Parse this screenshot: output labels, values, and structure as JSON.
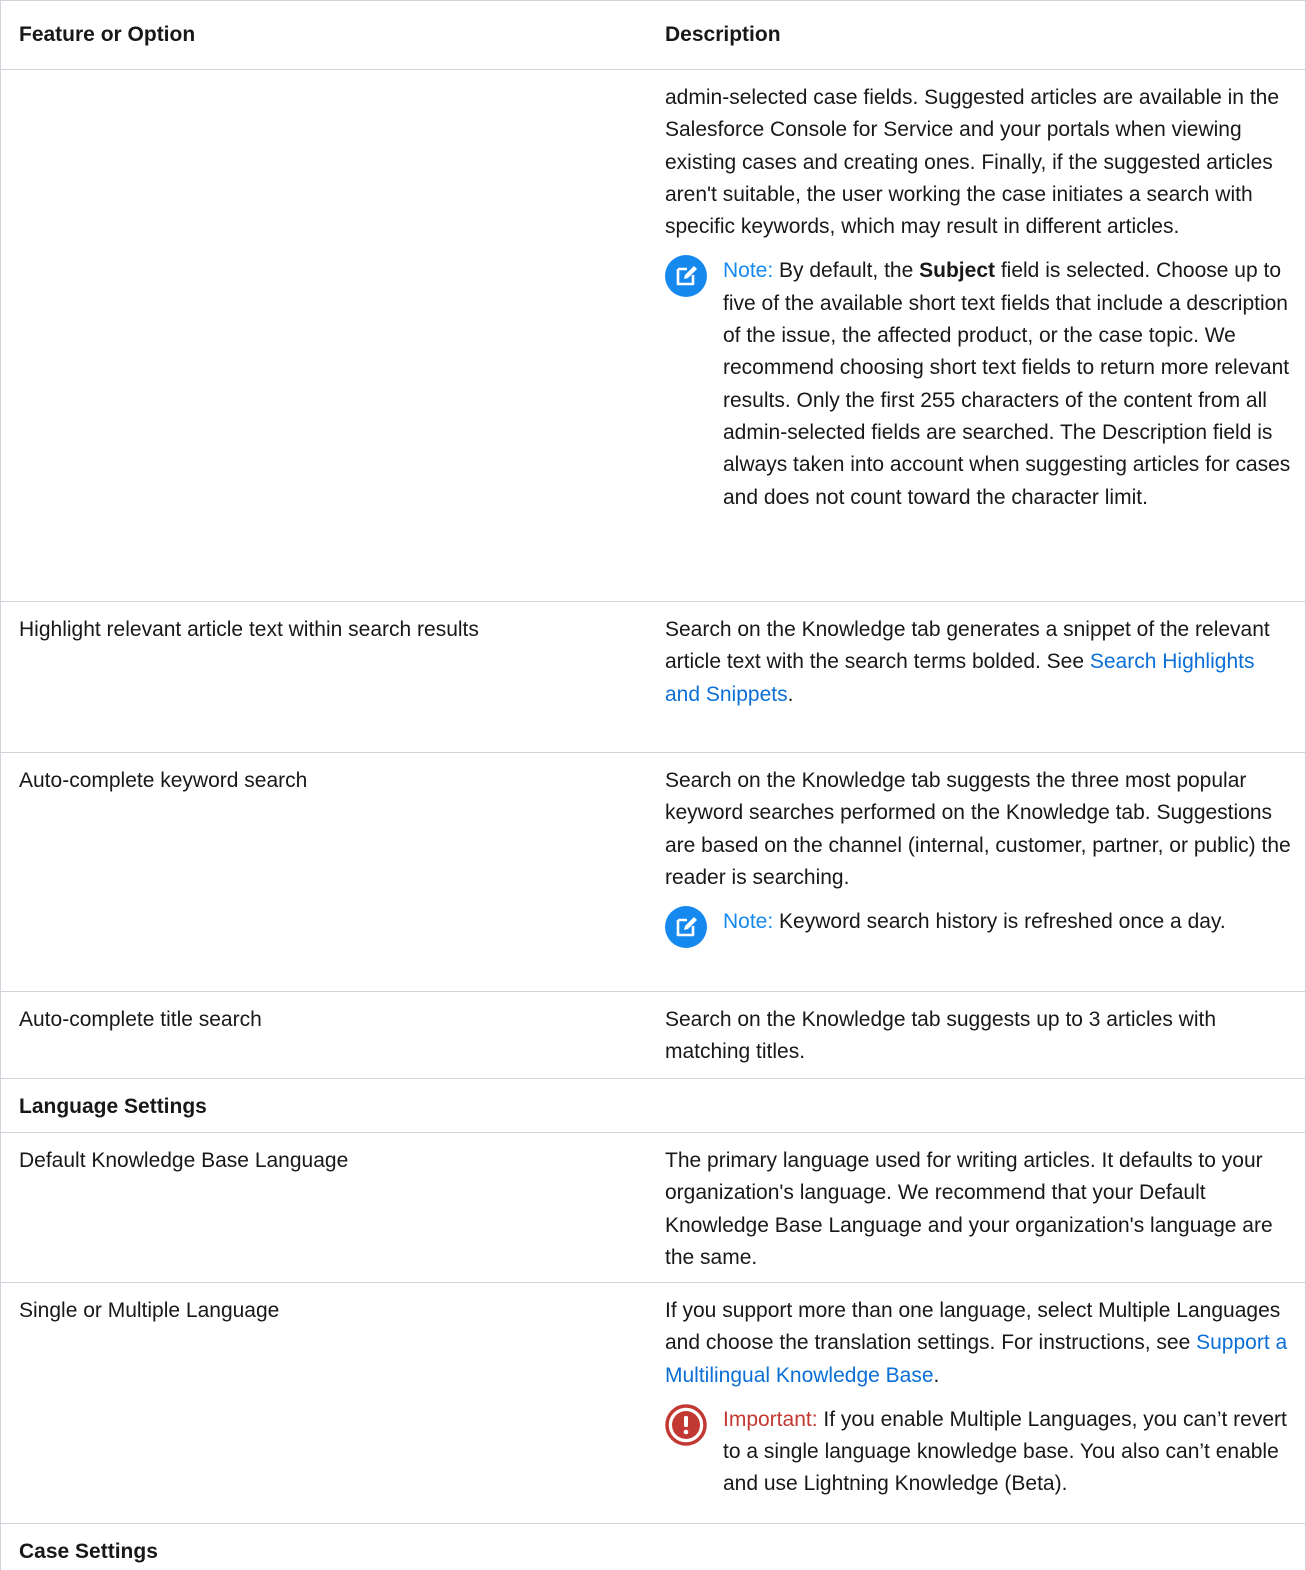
{
  "table": {
    "headers": {
      "feature": "Feature or Option",
      "description": "Description"
    },
    "continuation": {
      "text": "admin-selected case fields. Suggested articles are available in the Salesforce Console for Service and your portals when viewing existing cases and creating ones. Finally, if the suggested articles aren't suitable, the user working the case initiates a search with specific keywords, which may result in different articles.",
      "note": {
        "label": "Note:",
        "before": " By default, the ",
        "bold": "Subject",
        "after": " field is selected. Choose up to five of the available short text fields that include a description of the issue, the affected product, or the case topic. We recommend choosing short text fields to return more relevant results. Only the first 255 characters of the content from all admin-selected fields are searched. The Description field is always taken into account when suggesting articles for cases and does not count toward the character limit."
      }
    },
    "rows": [
      {
        "feature": "Highlight relevant article text within search results",
        "desc_before": "Search on the Knowledge tab generates a snippet of the relevant article text with the search terms bolded. See ",
        "link": "Search Highlights and Snippets",
        "desc_after": "."
      },
      {
        "feature": "Auto-complete keyword search",
        "desc": "Search on the Knowledge tab suggests the three most popular keyword searches performed on the Knowledge tab. Suggestions are based on the channel (internal, customer, partner, or public) the reader is searching.",
        "note_label": "Note:",
        "note_text": " Keyword search history is refreshed once a day."
      },
      {
        "feature": "Auto-complete title search",
        "desc": "Search on the Knowledge tab suggests up to 3 articles with matching titles."
      }
    ],
    "section_language": "Language Settings",
    "language_rows": [
      {
        "feature": "Default Knowledge Base Language",
        "desc": "The primary language used for writing articles. It defaults to your organization's language. We recommend that your Default Knowledge Base Language and your organization's language are the same."
      },
      {
        "feature": "Single or Multiple Language",
        "desc_before": "If you support more than one language, select Multiple Languages and choose the translation settings. For instructions, see ",
        "link": "Support a Multilingual Knowledge Base",
        "desc_after": ".",
        "important_label": "Important:",
        "important_text": " If you enable Multiple Languages, you can’t revert to a single language knowledge base. You also can’t enable and use Lightning Knowledge (Beta)."
      }
    ],
    "section_case": "Case Settings"
  },
  "colors": {
    "note": "#1589ee",
    "important": "#c23934",
    "link": "#0b6fd6",
    "border": "#cfd3da"
  },
  "icons": {
    "note": "edit-note-icon",
    "important": "exclamation-warning-icon"
  }
}
